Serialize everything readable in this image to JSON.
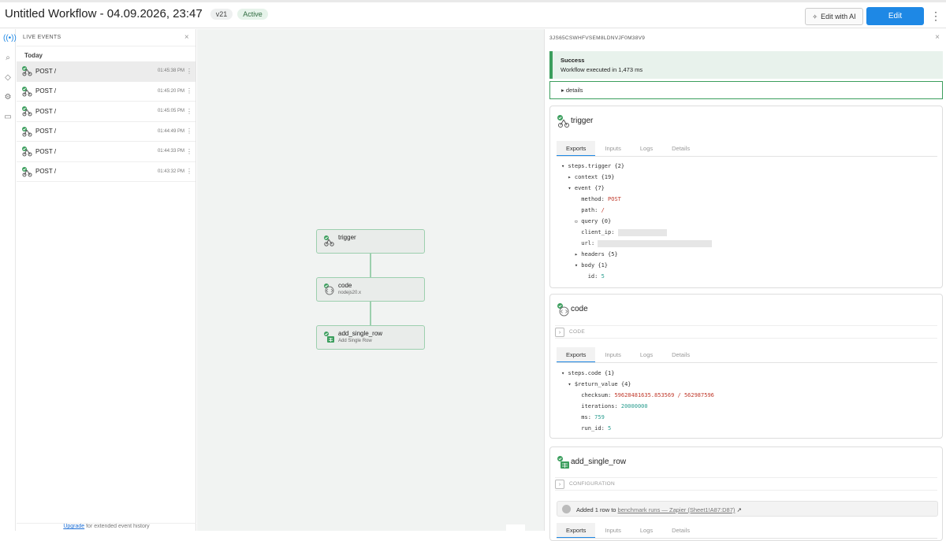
{
  "header": {
    "title": "Untitled Workflow - 04.09.2026, 23:47",
    "version": "v21",
    "status": "Active",
    "edit_ai_label": "Edit with AI",
    "edit_label": "Edit",
    "more": "⋮"
  },
  "events": {
    "header": "LIVE EVENTS",
    "close": "×",
    "today": "Today",
    "rows": [
      {
        "label": "POST /",
        "time": "01:45:38 PM"
      },
      {
        "label": "POST /",
        "time": "01:45:20 PM"
      },
      {
        "label": "POST /",
        "time": "01:45:05 PM"
      },
      {
        "label": "POST /",
        "time": "01:44:49 PM"
      },
      {
        "label": "POST /",
        "time": "01:44:33 PM"
      },
      {
        "label": "POST /",
        "time": "01:43:32 PM"
      }
    ],
    "upgrade_link": "Upgrade",
    "upgrade_text": " for extended event history"
  },
  "nodes": [
    {
      "name": "trigger",
      "sub": ""
    },
    {
      "name": "code",
      "sub": "nodejs20.x"
    },
    {
      "name": "add_single_row",
      "sub": "Add Single Row"
    }
  ],
  "inspector": {
    "id": "3JS65CSWHFVSEM8LDNVJF0M38V9",
    "close": "×",
    "success_title": "Success",
    "success_msg": "Workflow executed in 1,473 ms",
    "details": "▸ details",
    "tabs": [
      "Exports",
      "Inputs",
      "Logs",
      "Details"
    ],
    "trigger": {
      "title": "trigger",
      "l1": "steps.trigger {2}",
      "l2": "context {19}",
      "l3": "event {7}",
      "method_k": "method: ",
      "method_v": "POST",
      "path_k": "path: ",
      "path_v": "/",
      "query": "query {0}",
      "client_ip": "client_ip: ",
      "url": "url: ",
      "headers": "headers {5}",
      "body": "body {1}",
      "id_k": "id: ",
      "id_v": "5"
    },
    "code": {
      "title": "code",
      "bar": "CODE",
      "l1": "steps.code {1}",
      "l2": "$return_value {4}",
      "checksum_k": "checksum: ",
      "checksum_v": "59628481635.853569 / 562987596",
      "iter_k": "iterations: ",
      "iter_v": "20000000",
      "ms_k": "ms: ",
      "ms_v": "759",
      "run_k": "run_id: ",
      "run_v": "5"
    },
    "row": {
      "title": "add_single_row",
      "bar": "CONFIGURATION",
      "added_prefix": "Added 1 row to ",
      "added_link": "benchmark runs — Zapier (Sheet1!A87:D87)",
      "added_suffix": " ↗"
    }
  }
}
